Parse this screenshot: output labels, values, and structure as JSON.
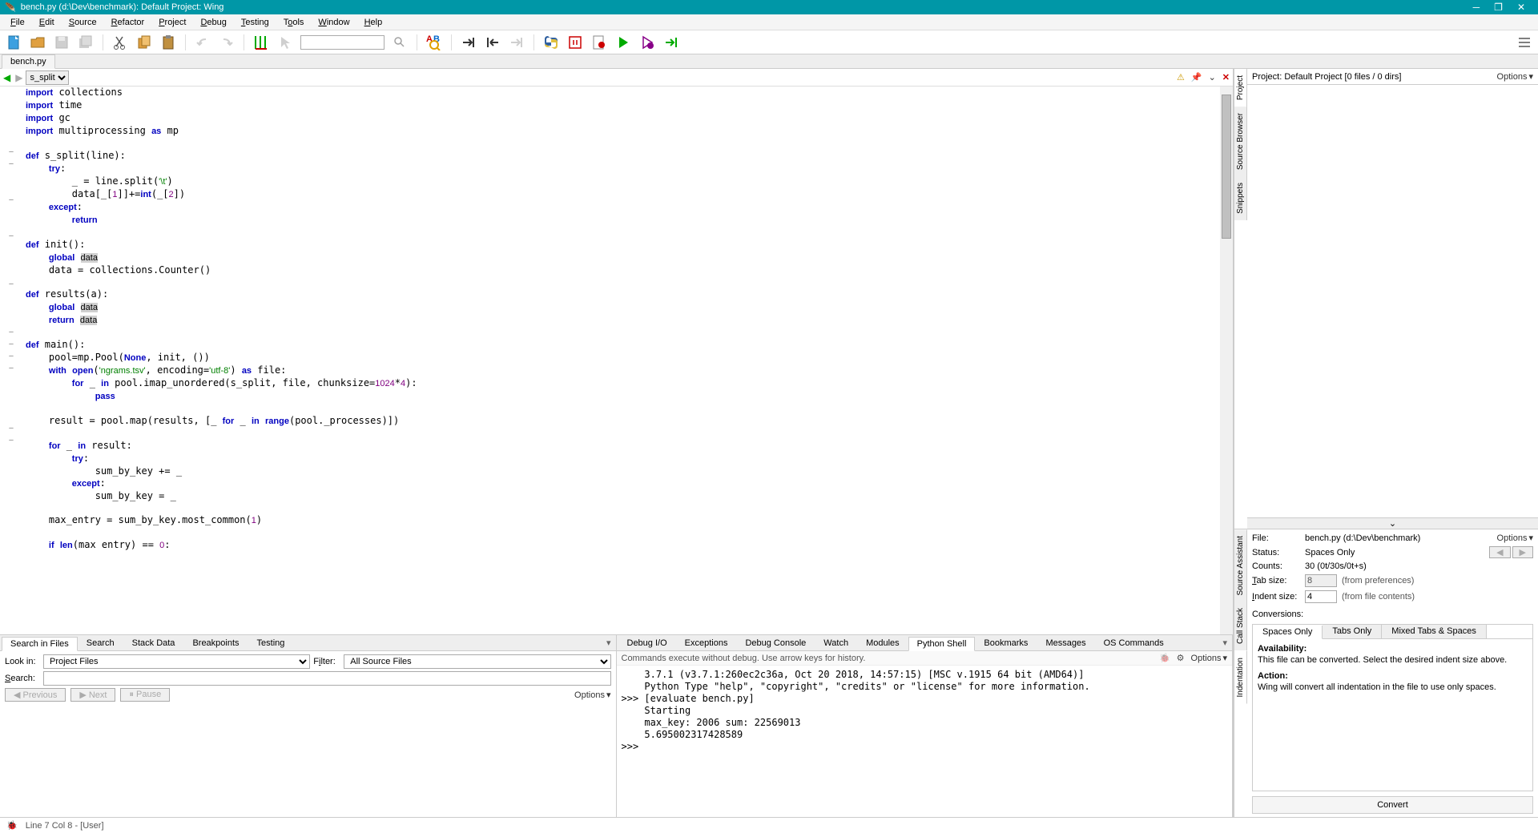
{
  "titlebar": {
    "title": "bench.py (d:\\Dev\\benchmark): Default Project: Wing"
  },
  "menubar": [
    "File",
    "Edit",
    "Source",
    "Refactor",
    "Project",
    "Debug",
    "Testing",
    "Tools",
    "Window",
    "Help"
  ],
  "main_tab": "bench.py",
  "editor": {
    "symbol_selector": "s_split",
    "code_lines": [
      "import collections",
      "import time",
      "import gc",
      "import multiprocessing as mp",
      "",
      "def s_split(line):",
      "    try:",
      "        _ = line.split('\\t')",
      "        data[_[1]]+=int(_[2])",
      "    except:",
      "        return",
      "",
      "def init():",
      "    global data",
      "    data = collections.Counter()",
      "",
      "def results(a):",
      "    global data",
      "    return data",
      "",
      "def main():",
      "    pool=mp.Pool(None, init, ())",
      "    with open('ngrams.tsv', encoding='utf-8') as file:",
      "        for _ in pool.imap_unordered(s_split, file, chunksize=1024*4):",
      "            pass",
      "",
      "    result = pool.map(results, [_ for _ in range(pool._processes)])",
      "",
      "    for _ in result:",
      "        try:",
      "            sum_by_key += _",
      "        except:",
      "            sum_by_key = _",
      "",
      "    max_entry = sum_by_key.most_common(1)",
      "",
      "    if len(max entry) == 0:"
    ]
  },
  "bottom_left": {
    "tabs": [
      "Search in Files",
      "Search",
      "Stack Data",
      "Breakpoints",
      "Testing"
    ],
    "active_tab": "Search in Files",
    "look_in_label": "Look in:",
    "look_in_value": "Project Files",
    "filter_label": "Filter:",
    "filter_value": "All Source Files",
    "search_label": "Search:",
    "search_value": "",
    "buttons": {
      "previous": "Previous",
      "next": "Next",
      "pause": "Pause"
    },
    "options": "Options"
  },
  "bottom_right": {
    "tabs": [
      "Debug I/O",
      "Exceptions",
      "Debug Console",
      "Watch",
      "Modules",
      "Python Shell",
      "Bookmarks",
      "Messages",
      "OS Commands"
    ],
    "active_tab": "Python Shell",
    "info": "Commands execute without debug.  Use arrow keys for history.",
    "options": "Options",
    "shell_lines": [
      "    3.7.1 (v3.7.1:260ec2c36a, Oct 20 2018, 14:57:15) [MSC v.1915 64 bit (AMD64)]",
      "    Python Type \"help\", \"copyright\", \"credits\" or \"license\" for more information.",
      ">>> [evaluate bench.py]",
      "    Starting",
      "    max_key: 2006 sum: 22569013",
      "    5.695002317428589",
      ">>> "
    ]
  },
  "right_top": {
    "side_tabs": [
      "Project",
      "Source Browser",
      "Snippets"
    ],
    "project_title": "Project: Default Project [0 files / 0 dirs]",
    "options": "Options"
  },
  "right_bottom": {
    "side_tabs": [
      "Source Assistant",
      "Call Stack",
      "Indentation"
    ],
    "file_label": "File:",
    "file_value": "bench.py (d:\\Dev\\benchmark)",
    "options": "Options",
    "status_label": "Status:",
    "status_value": "Spaces Only",
    "counts_label": "Counts:",
    "counts_value": "30 (0t/30s/0t+s)",
    "tabsize_label": "Tab size:",
    "tabsize_value": "8",
    "tabsize_note": "(from preferences)",
    "indent_label": "Indent size:",
    "indent_value": "4",
    "indent_note": "(from file contents)",
    "conversions_label": "Conversions:",
    "conv_tabs": [
      "Spaces Only",
      "Tabs Only",
      "Mixed Tabs & Spaces"
    ],
    "availability_hdr": "Availability:",
    "availability_txt": "This file can be converted. Select the desired indent size above.",
    "action_hdr": "Action:",
    "action_txt": "Wing will convert all indentation in the file to use only spaces.",
    "convert_btn": "Convert"
  },
  "statusbar": {
    "pos": "Line 7 Col 8 - [User]"
  }
}
